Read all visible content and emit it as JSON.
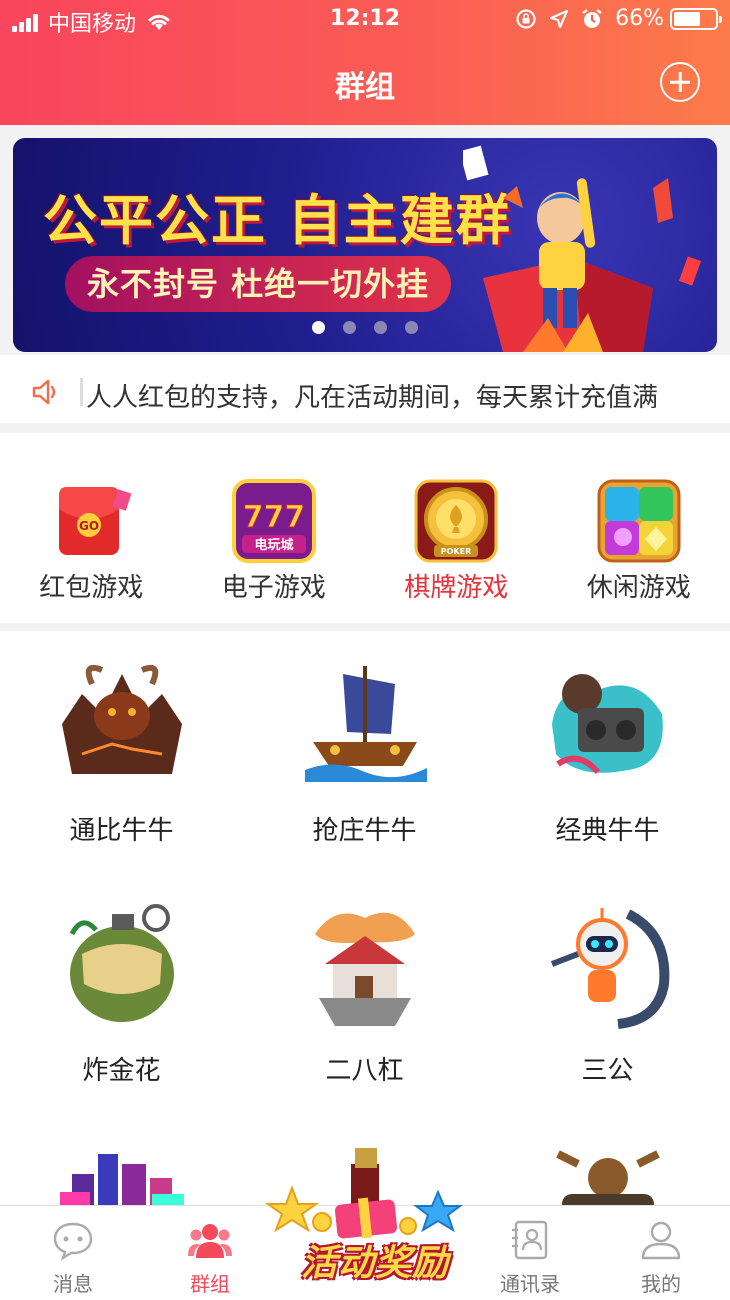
{
  "status_bar": {
    "carrier": "中国移动",
    "time": "12:12",
    "battery": "66%",
    "battery_level": 0.66,
    "icons": [
      "signal-icon",
      "wifi-icon",
      "rotation-lock-icon",
      "location-icon",
      "alarm-icon",
      "battery-icon"
    ]
  },
  "header": {
    "title": "群组",
    "add_icon": "plus-circle-icon"
  },
  "banner": {
    "headline": "公平公正 自主建群",
    "subline": "永不封号 杜绝一切外挂",
    "slide_count": 4,
    "active_slide": 1,
    "colors": {
      "background": "#201e8e",
      "headline": "#ffe14a",
      "accent": "#e2334a"
    }
  },
  "notice": {
    "icon": "speaker-icon",
    "text": "人人红包的支持，凡在活动期间，每天累计充值满"
  },
  "categories": [
    {
      "label": "红包游戏",
      "icon": "red-envelope-icon",
      "active": false
    },
    {
      "label": "电子游戏",
      "icon": "slot-777-icon",
      "active": false
    },
    {
      "label": "棋牌游戏",
      "icon": "poker-chip-icon",
      "active": true
    },
    {
      "label": "休闲游戏",
      "icon": "gem-puzzle-icon",
      "active": false
    }
  ],
  "games": [
    {
      "label": "通比牛牛",
      "art": "bull-demon-art"
    },
    {
      "label": "抢庄牛牛",
      "art": "pirate-ship-art"
    },
    {
      "label": "经典牛牛",
      "art": "graffiti-boombox-art"
    },
    {
      "label": "炸金花",
      "art": "grenade-island-art"
    },
    {
      "label": "二八杠",
      "art": "floating-house-art"
    },
    {
      "label": "三公",
      "art": "robot-art"
    },
    {
      "label": "",
      "art": "neon-city-art"
    },
    {
      "label": "",
      "art": "treasure-tower-art"
    },
    {
      "label": "",
      "art": "steampunk-art"
    }
  ],
  "tabbar": {
    "items": [
      {
        "label": "消息",
        "icon": "chat-bubble-icon",
        "active": false
      },
      {
        "label": "群组",
        "icon": "group-people-icon",
        "active": true
      },
      {
        "label": "活动奖励",
        "icon": "star-reward-icon",
        "active": false
      },
      {
        "label": "通讯录",
        "icon": "contacts-book-icon",
        "active": false
      },
      {
        "label": "我的",
        "icon": "profile-icon",
        "active": false
      }
    ],
    "colors": {
      "active": "#f44a5c",
      "inactive": "#777777"
    }
  }
}
